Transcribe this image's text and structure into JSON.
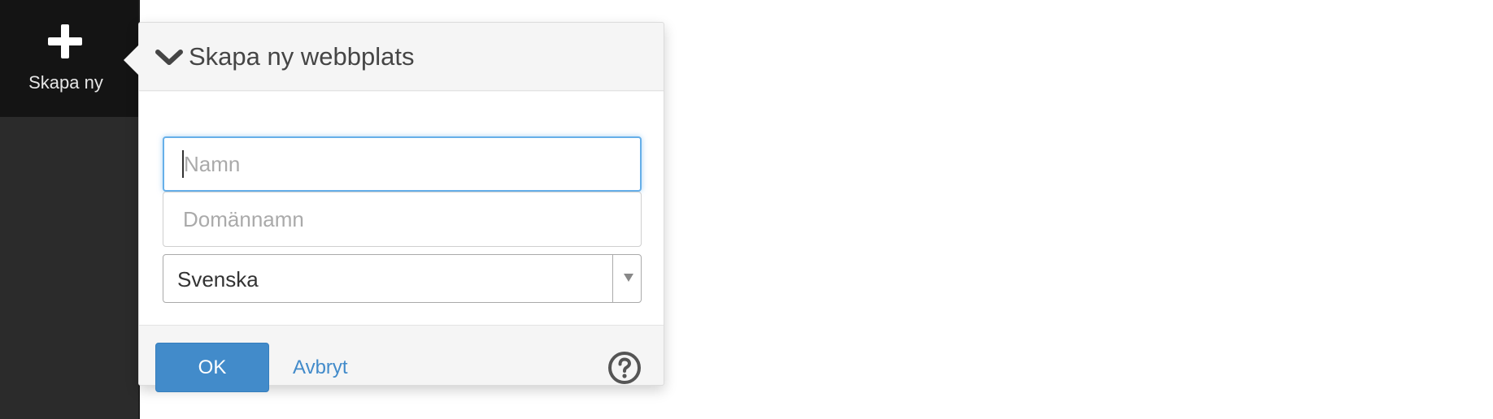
{
  "sidebar": {
    "create_label": "Skapa ny",
    "create_icon": "plus-icon"
  },
  "dialog": {
    "title": "Skapa ny webbplats",
    "collapse_icon": "chevron-down-icon",
    "name_placeholder": "Namn",
    "name_value": "",
    "domain_placeholder": "Domännamn",
    "domain_value": "",
    "language_selected": "Svenska",
    "ok_label": "OK",
    "cancel_label": "Avbryt",
    "help_icon": "question-circle-icon"
  },
  "colors": {
    "sidebar_bg": "#2b2b2b",
    "primary_button": "#428bca",
    "link": "#428bca",
    "focus_ring": "#66afe9"
  }
}
